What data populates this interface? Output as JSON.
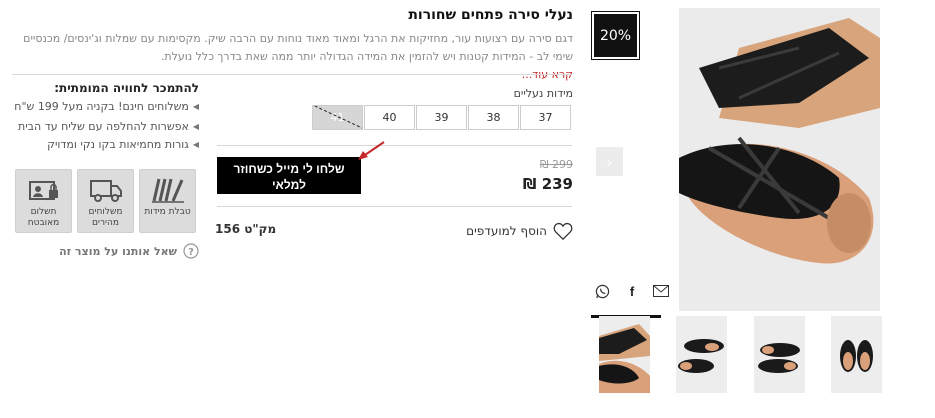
{
  "product": {
    "title": "נעלי סירה פתחים שחורות",
    "description_line1": "דגם סירה עם רצועות עור, מחזיקות את הרגל ומאוד מאוד נוחות עם הרבה שיק. מקסימות עם שמלות וג'ינסים/ מכנסיים",
    "description_line2": "שימי לב - המידות קטנות ויש להזמין את המידה הגדולה יותר ממה שאת בדרך כלל נועלת.",
    "read_more": "קרא עוד..."
  },
  "sizes": {
    "label": "מידות נעליים",
    "options": [
      {
        "value": "37",
        "available": true
      },
      {
        "value": "38",
        "available": true
      },
      {
        "value": "39",
        "available": true
      },
      {
        "value": "40",
        "available": true
      },
      {
        "value": "41",
        "available": false
      }
    ]
  },
  "pricing": {
    "old_price": "299 ₪",
    "price": "239 ₪",
    "discount_badge": "20%",
    "restock_button": "שלחו לי מייל כשחוזר למלאי"
  },
  "wishlist": {
    "label": "הוסף למועדפים"
  },
  "sku": {
    "text": "מק\"ט 156"
  },
  "benefits": {
    "title": "להתמכר לחוויה המומתית:",
    "items": [
      "משלוחים חינם! בקניה מעל 199 ש\"ח",
      "אפשרות להחלפה עם שליח עד הבית",
      "גורות מחמיאות בקו נקי ומדויק"
    ]
  },
  "tiles": [
    {
      "label": "טבלת מידות",
      "icon": "size-chart-icon"
    },
    {
      "label": "משלוחים מהירים",
      "icon": "delivery-truck-icon"
    },
    {
      "label": "תשלום מאובטח",
      "icon": "secure-payment-icon"
    }
  ],
  "ask": {
    "label": "שאל אותנו על מוצר זה"
  },
  "share": {
    "icons": [
      "email-icon",
      "facebook-icon",
      "whatsapp-icon"
    ]
  },
  "gallery": {
    "thumbnail_count": 4,
    "selected_index": 3
  },
  "colors": {
    "accent_red": "#c62828",
    "badge_bg": "#111111",
    "tile_bg": "#dcdcdc",
    "leather": "#1a1a1a",
    "sole": "#d9a07a"
  }
}
